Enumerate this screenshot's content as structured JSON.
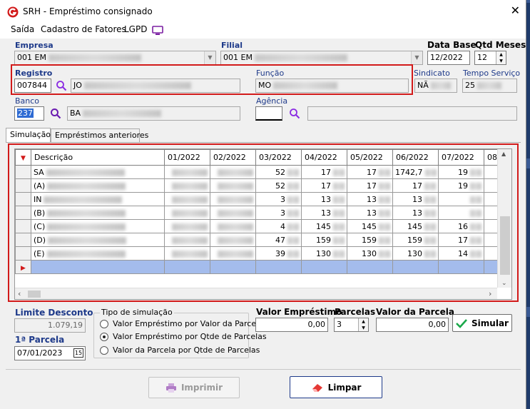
{
  "window": {
    "title": "SRH - Empréstimo consignado",
    "close_glyph": "✕"
  },
  "menu": {
    "items": [
      "Saída",
      "Cadastro de Fatores",
      "LGPD"
    ]
  },
  "form": {
    "empresa_label": "Empresa",
    "empresa_value": "001 EM",
    "filial_label": "Filial",
    "filial_value": "001 EM",
    "data_base_label": "Data Base",
    "data_base_value": "12/2022",
    "qtd_meses_label": "Qtd Meses",
    "qtd_meses_value": "12",
    "registro_label": "Registro",
    "registro_value": "007844",
    "nome_value": "JO",
    "funcao_label": "Função",
    "funcao_value": "MO",
    "sindicato_label": "Sindicato",
    "sindicato_value": "NÃ",
    "tempo_servico_label": "Tempo Serviço",
    "tempo_servico_value": "25",
    "banco_label": "Banco",
    "banco_value": "237",
    "banco_nome_value": "BA",
    "agencia_label": "Agência",
    "agencia_value": ""
  },
  "tabs": [
    {
      "label": "Simulação",
      "active": true
    },
    {
      "label": "Empréstimos anteriores",
      "active": false
    }
  ],
  "grid": {
    "columns": [
      "Descrição",
      "01/2022",
      "02/2022",
      "03/2022",
      "04/2022",
      "05/2022",
      "06/2022",
      "07/2022",
      "08"
    ],
    "rows": [
      [
        "SA",
        "",
        "",
        "52",
        "17",
        "17",
        "1742,7",
        "19",
        ""
      ],
      [
        "(A)",
        "",
        "",
        "52",
        "17",
        "17",
        "17",
        "19",
        ""
      ],
      [
        "IN",
        "",
        "",
        "3",
        "13",
        "13",
        "13",
        "",
        ""
      ],
      [
        "(B)",
        "",
        "",
        "3",
        "13",
        "13",
        "13",
        "",
        ""
      ],
      [
        "(C)",
        "",
        "",
        "4",
        "145",
        "145",
        "145",
        "16",
        ""
      ],
      [
        "(D)",
        "",
        "",
        "47",
        "159",
        "159",
        "159",
        "17",
        ""
      ],
      [
        "(E)",
        "",
        "",
        "39",
        "130",
        "130",
        "130",
        "14",
        ""
      ]
    ]
  },
  "bottom": {
    "limite_desconto_label": "Limite Desconto",
    "limite_desconto_value": "1.079,19",
    "primeira_parcela_label": "1ª Parcela",
    "primeira_parcela_value": "07/01/2023",
    "tipo_simulacao_label": "Tipo de simulação",
    "tipo_options": [
      {
        "label": "Valor Empréstimo por Valor da Parcela",
        "selected": false
      },
      {
        "label": "Valor Empréstimo por Qtde de Parcelas",
        "selected": true
      },
      {
        "label": "Valor da Parcela por Qtde de Parcelas",
        "selected": false
      }
    ],
    "valor_emprestimo_label": "Valor Empréstimo",
    "valor_emprestimo_value": "0,00",
    "parcelas_label": "Parcelas",
    "parcelas_value": "3",
    "valor_parcela_label": "Valor da Parcela",
    "valor_parcela_value": "0,00",
    "simular_label": "Simular",
    "imprimir_label": "Imprimir",
    "limpar_label": "Limpar"
  },
  "colors": {
    "accent": "#1e3a8a",
    "highlight_box": "#d21a1a",
    "selection_row": "#a4bcec"
  }
}
